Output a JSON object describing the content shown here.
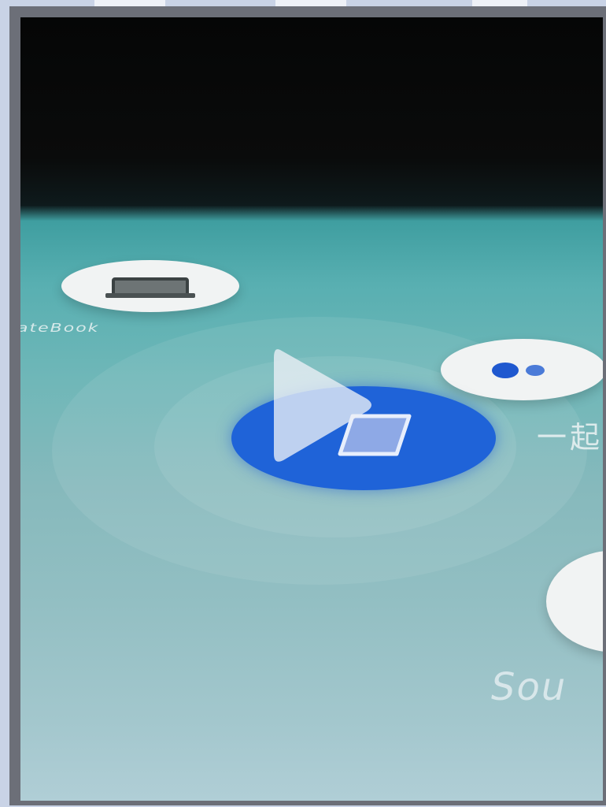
{
  "video": {
    "node_labels": {
      "laptop": "ateBook",
      "earbuds": "一起",
      "sound": "Sou"
    },
    "icons": [
      "laptop-icon",
      "earbuds-icon",
      "phone-icon",
      "play-icon"
    ],
    "accent_color": "#1f63d8"
  }
}
